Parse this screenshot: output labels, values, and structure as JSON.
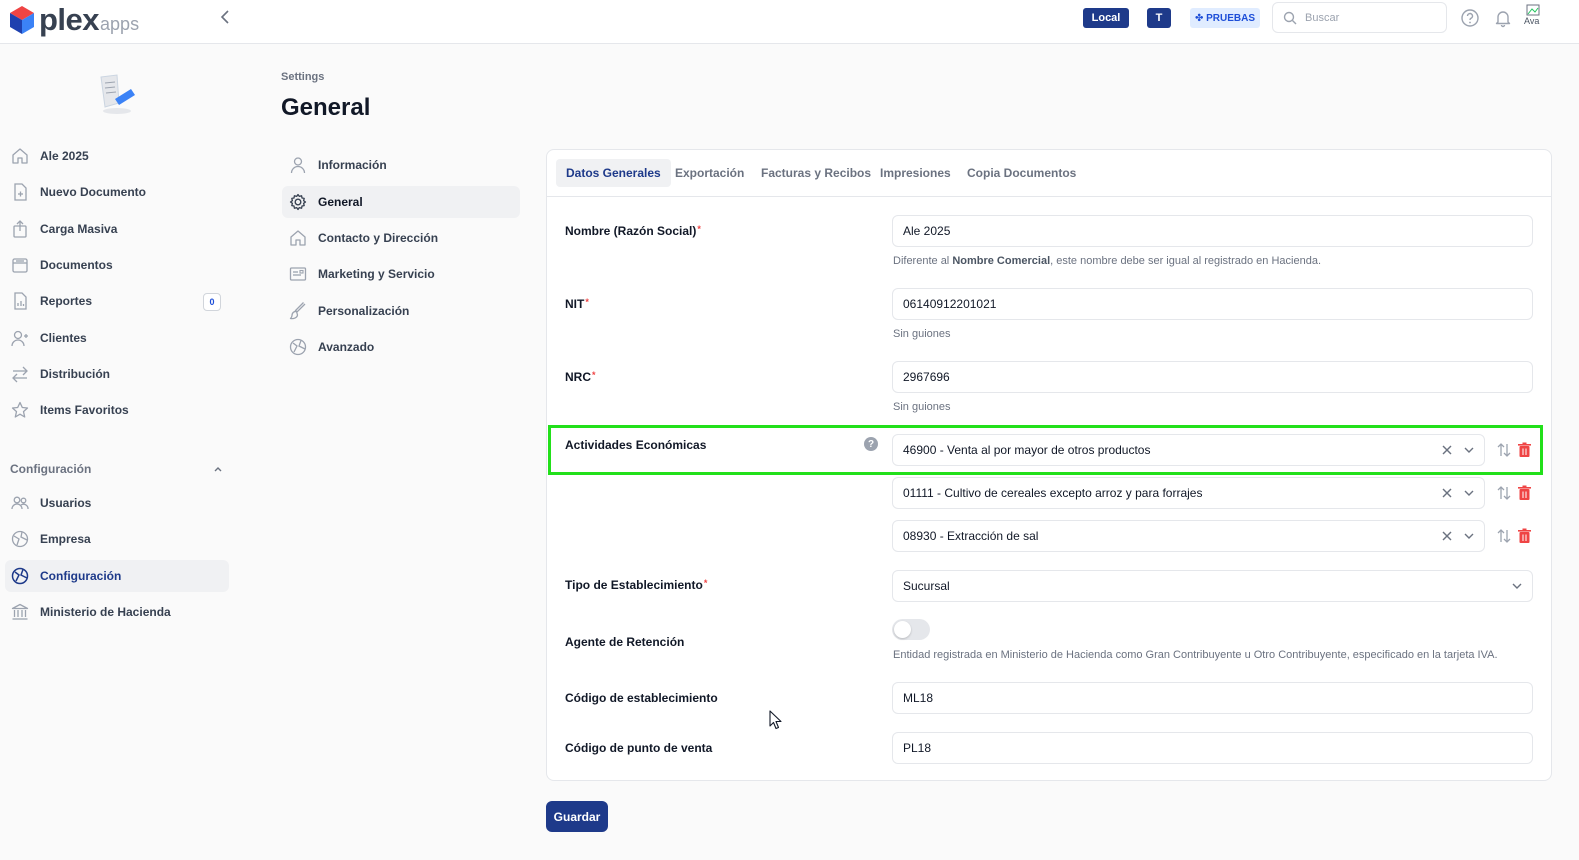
{
  "app": {
    "logo_text": "plex",
    "logo_sub": "apps"
  },
  "topbar": {
    "env_label": "Local",
    "user_initial": "T",
    "mode_label": "✤ PRUEBAS",
    "search_placeholder": "Buscar",
    "avatar_alt": "Ava"
  },
  "sidebar": {
    "items": [
      {
        "label": "Ale 2025",
        "icon": "home-icon"
      },
      {
        "label": "Nuevo Documento",
        "icon": "document-add-icon"
      },
      {
        "label": "Carga Masiva",
        "icon": "upload-icon"
      },
      {
        "label": "Documentos",
        "icon": "archive-icon"
      },
      {
        "label": "Reportes",
        "icon": "report-icon",
        "badge": "0"
      },
      {
        "label": "Clientes",
        "icon": "user-add-icon"
      },
      {
        "label": "Distribución",
        "icon": "arrows-icon"
      },
      {
        "label": "Items Favoritos",
        "icon": "star-icon"
      }
    ],
    "section_label": "Configuración",
    "config_items": [
      {
        "label": "Usuarios",
        "icon": "users-icon"
      },
      {
        "label": "Empresa",
        "icon": "building-icon"
      },
      {
        "label": "Configuración",
        "icon": "settings-icon",
        "active": true
      },
      {
        "label": "Ministerio de Hacienda",
        "icon": "bank-icon"
      }
    ]
  },
  "settings": {
    "breadcrumb": "Settings",
    "title": "General",
    "nav": [
      {
        "label": "Información",
        "icon": "user-icon"
      },
      {
        "label": "General",
        "icon": "gear-icon",
        "active": true
      },
      {
        "label": "Contacto y Dirección",
        "icon": "home-icon"
      },
      {
        "label": "Marketing y Servicio",
        "icon": "marketing-icon"
      },
      {
        "label": "Personalización",
        "icon": "brush-icon"
      },
      {
        "label": "Avanzado",
        "icon": "advanced-icon"
      }
    ]
  },
  "tabs": [
    {
      "label": "Datos Generales",
      "active": true
    },
    {
      "label": "Exportación"
    },
    {
      "label": "Facturas y Recibos"
    },
    {
      "label": "Impresiones"
    },
    {
      "label": "Copia Documentos"
    }
  ],
  "form": {
    "nombre": {
      "label": "Nombre (Razón Social)",
      "value": "Ale 2025",
      "help_prefix": "Diferente al ",
      "help_bold": "Nombre Comercial",
      "help_suffix": ", este nombre debe ser igual al registrado en Hacienda."
    },
    "nit": {
      "label": "NIT",
      "value": "06140912201021",
      "help": "Sin guiones"
    },
    "nrc": {
      "label": "NRC",
      "value": "2967696",
      "help": "Sin guiones"
    },
    "actividades": {
      "label": "Actividades Económicas",
      "help_icon": "?",
      "values": [
        "46900 - Venta al por mayor de otros productos",
        "01111 - Cultivo de cereales excepto arroz y para forrajes",
        "08930 - Extracción de sal"
      ]
    },
    "tipo": {
      "label": "Tipo de Establecimiento",
      "value": "Sucursal"
    },
    "agente": {
      "label": "Agente de Retención",
      "enabled": false,
      "help": "Entidad registrada en Ministerio de Hacienda como Gran Contribuyente u Otro Contribuyente, especificado en la tarjeta IVA."
    },
    "cod_establecimiento": {
      "label": "Código de establecimiento",
      "value": "ML18"
    },
    "cod_punto_venta": {
      "label": "Código de punto de venta",
      "value": "PL18"
    }
  },
  "actions": {
    "save_label": "Guardar"
  },
  "colors": {
    "brand_navy": "#1e3a8a",
    "highlight": "#22e01a",
    "danger": "#ef4444"
  }
}
